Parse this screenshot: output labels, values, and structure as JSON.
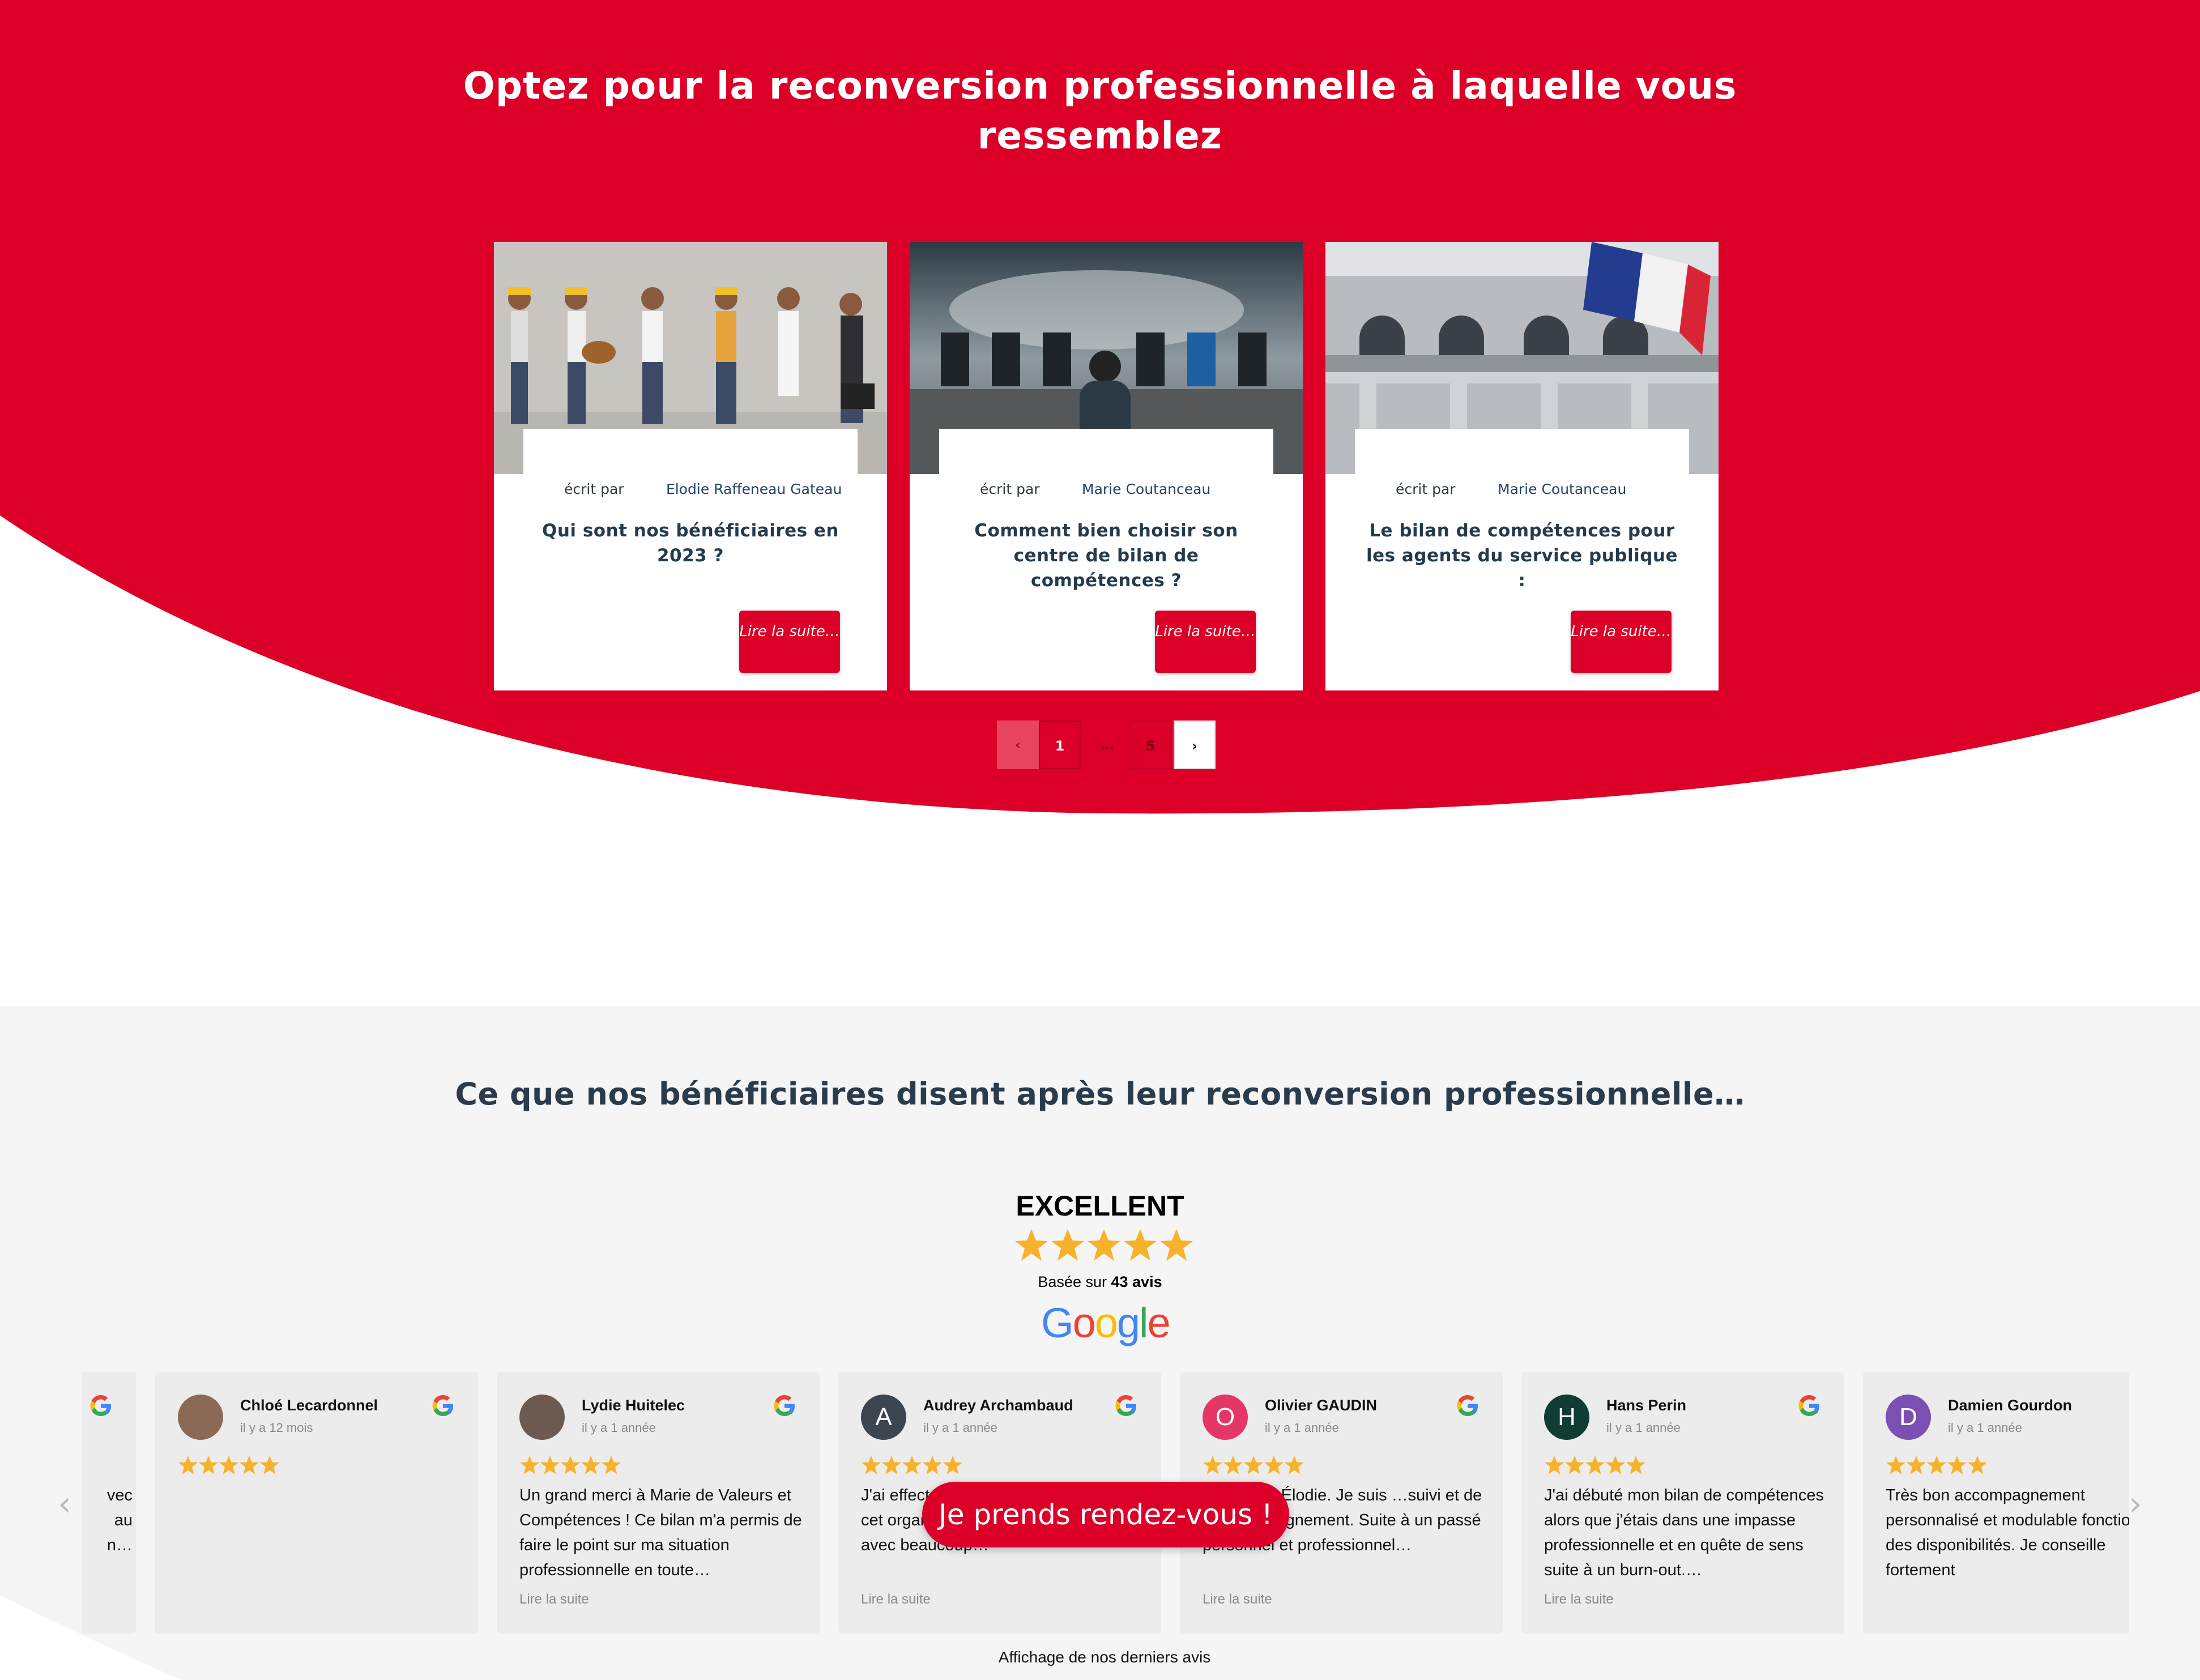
{
  "hero": {
    "title": "Optez pour la reconversion professionnelle à laquelle vous ressemblez"
  },
  "articles": [
    {
      "written_by": "écrit par",
      "author": "Elodie Raffeneau Gateau",
      "title": "Qui sont nos bénéficiaires en 2023 ?",
      "cta": "Lire la suite…"
    },
    {
      "written_by": "écrit par",
      "author": "Marie Coutanceau",
      "title": "Comment bien choisir son centre de bilan de compétences ?",
      "cta": "Lire la suite…"
    },
    {
      "written_by": "écrit par",
      "author": "Marie Coutanceau",
      "title": "Le bilan de compétences pour les agents du service publique :",
      "cta": "Lire la suite…"
    }
  ],
  "pagination": {
    "prev": "‹",
    "current": "1",
    "ellipsis": "…",
    "last": "5",
    "next": "›"
  },
  "reviews": {
    "title": "Ce que nos bénéficiaires disent après leur reconversion professionnelle…",
    "rating_label": "EXCELLENT",
    "based_prefix": "Basée sur",
    "based_count": "43 avis",
    "provider": "Google",
    "partial_left_lines": [
      "vec",
      "",
      "au",
      "n…"
    ],
    "items": [
      {
        "name": "Chloé Lecardonnel",
        "date": "il y a 12 mois",
        "text": "",
        "more": "",
        "initial": "",
        "color": "#8b6a55"
      },
      {
        "name": "Lydie Huitelec",
        "date": "il y a 1 année",
        "text": "Un grand merci à Marie de Valeurs et Compétences ! Ce bilan m'a permis de faire le point sur ma situation professionnelle en toute…",
        "more": "Lire la suite",
        "initial": "",
        "color": "#6d5b52"
      },
      {
        "name": "Audrey Archambaud",
        "date": "il y a 1 année",
        "text": "J'ai effect… compéte… trouvé dans cet organisme un accompagnement avec beaucoup…",
        "more": "Lire la suite",
        "initial": "A",
        "color": "#3b4650"
      },
      {
        "name": "Olivier GAUDIN",
        "date": "il y a 1 année",
        "text": "…ué avec Élodie. Je suis …suivi et de …accompagnement. Suite à un passé personnel et professionnel…",
        "more": "Lire la suite",
        "initial": "O",
        "color": "#e53668"
      },
      {
        "name": "Hans Perin",
        "date": "il y a 1 année",
        "text": "J'ai débuté mon bilan de compétences alors que j'étais dans une impasse professionnelle et en quête de sens suite à un burn-out.…",
        "more": "Lire la suite",
        "initial": "H",
        "color": "#0f3d33"
      },
      {
        "name": "Damien Gourdon",
        "date": "il y a 1 année",
        "text": "Très bon accompagnement personnalisé et modulable fonction des disponibilités. Je conseille fortement",
        "more": "",
        "initial": "D",
        "color": "#7b4fb4"
      }
    ],
    "cta": "Je prends rendez-vous !",
    "footer": "Affichage de nos derniers avis"
  },
  "colors": {
    "brand_red": "#dc0028",
    "star": "#f6b22b"
  }
}
